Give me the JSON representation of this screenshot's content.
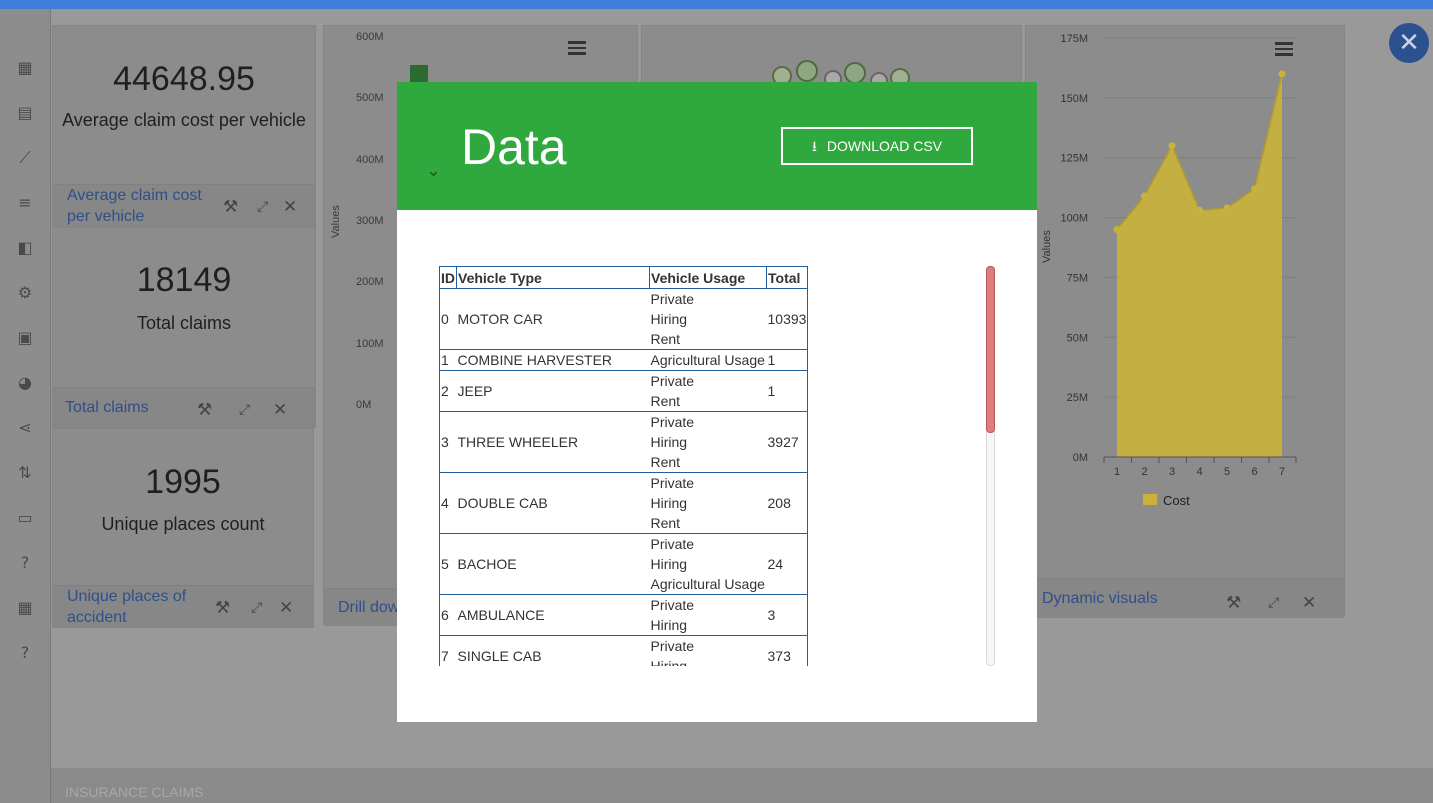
{
  "sidebar": {
    "icons": [
      "dashboard-icon",
      "document-icon",
      "trending-icon",
      "list-icon",
      "widgets-icon",
      "settings-icon",
      "save-icon",
      "palette-icon",
      "share-icon",
      "import-export-icon",
      "monitor-icon",
      "help-icon",
      "grid-icon",
      "help-icon-2"
    ]
  },
  "kpi1": {
    "value": "44648.95",
    "label": "Average claim cost per vehicle",
    "footer_line1": "Average claim cost",
    "footer_line2": "per vehicle"
  },
  "kpi2": {
    "value": "18149",
    "label": "Total claims",
    "footer": "Total claims"
  },
  "kpi3": {
    "value": "1995",
    "label": "Unique places count",
    "footer_line1": "Unique places of",
    "footer_line2": "accident"
  },
  "drill_panel": {
    "footer": "Drill dow",
    "axis_title": "Values",
    "y_ticks": [
      "600M",
      "500M",
      "400M",
      "300M",
      "200M",
      "100M",
      "0M"
    ]
  },
  "area_panel": {
    "footer": "Dynamic visuals",
    "legend": "Cost",
    "axis_title": "Values"
  },
  "chart_data": {
    "type": "area",
    "x": [
      1,
      2,
      3,
      4,
      5,
      6,
      7
    ],
    "series": [
      {
        "name": "Cost",
        "values": [
          95000000,
          109000000,
          130000000,
          103000000,
          104000000,
          112000000,
          160000000
        ]
      }
    ],
    "ylabel": "Values",
    "ylim": [
      0,
      175000000
    ],
    "y_ticks": [
      "175M",
      "150M",
      "125M",
      "100M",
      "75M",
      "50M",
      "25M",
      "0M"
    ],
    "color": "#c9b23a"
  },
  "bottom": {
    "label": "INSURANCE CLAIMS"
  },
  "modal": {
    "title": "Data",
    "download_label": "DOWNLOAD CSV",
    "columns": [
      "ID",
      "Vehicle Type",
      "Vehicle Usage",
      "Total"
    ],
    "rows": [
      {
        "id": "0",
        "type": "MOTOR CAR",
        "usage": [
          "Private",
          "Hiring",
          "Rent"
        ],
        "total": "10393"
      },
      {
        "id": "1",
        "type": "COMBINE HARVESTER",
        "usage": [
          "Agricultural Usage"
        ],
        "total": "1"
      },
      {
        "id": "2",
        "type": "JEEP",
        "usage": [
          "Private",
          "Rent"
        ],
        "total": "1"
      },
      {
        "id": "3",
        "type": "THREE WHEELER",
        "usage": [
          "Private",
          "Hiring",
          "Rent"
        ],
        "total": "3927"
      },
      {
        "id": "4",
        "type": "DOUBLE CAB",
        "usage": [
          "Private",
          "Hiring",
          "Rent"
        ],
        "total": "208"
      },
      {
        "id": "5",
        "type": "BACHOE",
        "usage": [
          "Private",
          "Hiring",
          "Agricultural Usage"
        ],
        "total": "24"
      },
      {
        "id": "6",
        "type": "AMBULANCE",
        "usage": [
          "Private",
          "Hiring"
        ],
        "total": "3"
      },
      {
        "id": "7",
        "type": "SINGLE CAB",
        "usage": [
          "Private",
          "Hiring"
        ],
        "total": "373"
      }
    ]
  },
  "colors": {
    "header_green": "#2fa83e",
    "table_border": "#1f5f9e",
    "scroll_thumb": "#e07c7c",
    "close_fab": "#2b5190"
  }
}
